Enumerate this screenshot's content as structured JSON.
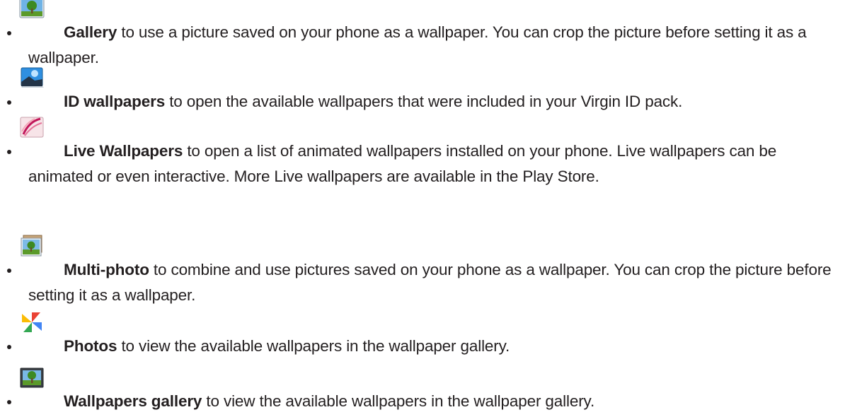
{
  "items": [
    {
      "icon": "gallery-icon",
      "term": "Gallery",
      "desc": " to use a picture saved on your phone as a wallpaper. You can crop the picture before setting it as a wallpaper."
    },
    {
      "icon": "id-wallpapers-icon",
      "term": "ID wallpapers",
      "desc": " to open the available wallpapers that were included in your Virgin ID pack."
    },
    {
      "icon": "live-wallpapers-icon",
      "term": "Live Wallpapers",
      "desc": " to open a list of animated wallpapers installed on your phone. Live wallpapers can be animated or even interactive. More Live wallpapers are available in the Play Store."
    },
    {
      "icon": "multi-photo-icon",
      "term": "Multi-photo",
      "desc": " to combine and use pictures saved on your phone as a wallpaper. You can crop the picture before setting it as a wallpaper."
    },
    {
      "icon": "photos-icon",
      "term": "Photos",
      "desc": " to view the available wallpapers in the wallpaper gallery."
    },
    {
      "icon": "wallpapers-gallery-icon",
      "term": "Wallpapers gallery",
      "desc": " to view the available wallpapers in the wallpaper gallery."
    }
  ]
}
